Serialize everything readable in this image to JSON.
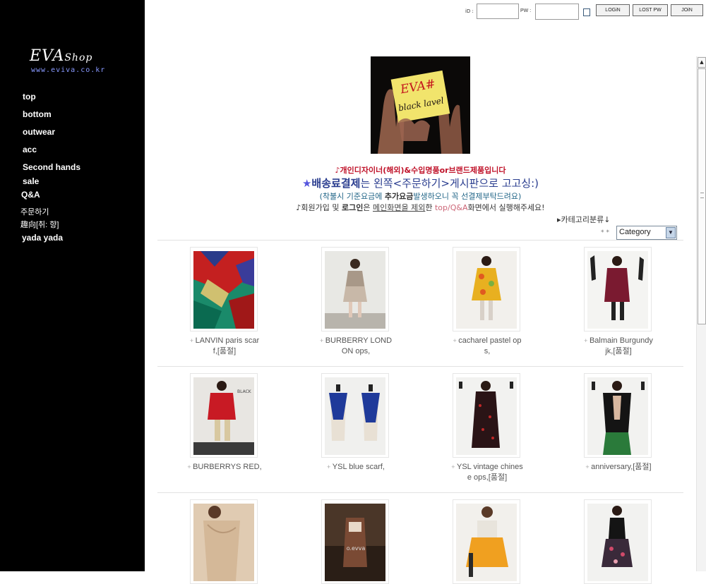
{
  "sidebar": {
    "logo_brand": "EVA",
    "logo_shop": "Shop",
    "logo_url": "www.eviva.co.kr",
    "items": [
      {
        "label": "top"
      },
      {
        "label": "bottom"
      },
      {
        "label": "outwear"
      },
      {
        "label": "acc"
      },
      {
        "label": "Second hands"
      },
      {
        "label": "sale"
      },
      {
        "label": "Q&A"
      },
      {
        "label": "주문하기"
      },
      {
        "label": "趣向[취:  향]"
      },
      {
        "label": "yada yada"
      }
    ]
  },
  "login": {
    "id_label": "iD :",
    "pw_label": "PW :",
    "login_button": "LOGiN",
    "lost_pw_button": "LOST PW",
    "join_button": "JOiN"
  },
  "banner": {
    "line1": "EVA#",
    "line2": "black lavel"
  },
  "notices": {
    "line1": "♪개인디자이너(해외)&수입명품or브랜드제품입니다",
    "line2_star": "★",
    "line2_bold": "배송료결제",
    "line2_rest": "는 왼쪽<주문하기>게시판으로 고고싱:)",
    "line3_a": "(착불시 기준요금에 ",
    "line3_bold": "추가요금",
    "line3_b": "발생하오니 꼭 선결제부탁드려요)",
    "line4_a": "♪회원가입 및 ",
    "line4_bold": "로그인",
    "line4_b": "은 ",
    "line4_u": "메인화면을 제외",
    "line4_c": "한 ",
    "line4_pink": "top/Q&A",
    "line4_d": "화면에서 실행해주세요!"
  },
  "category": {
    "label": "▸카테고리분류↓",
    "stars": "**",
    "selected": "Category"
  },
  "products": [
    {
      "name_line1": "LANVIN paris scar",
      "name_line2": "f,[품절]"
    },
    {
      "name_line1": "BURBERRY LOND",
      "name_line2": "ON ops,"
    },
    {
      "name_line1": "cacharel pastel op",
      "name_line2": "s,"
    },
    {
      "name_line1": "Balmain Burgundy",
      "name_line2": "jk,[품절]"
    },
    {
      "name_line1": "BURBERRYS RED,",
      "name_line2": ""
    },
    {
      "name_line1": "YSL blue scarf,",
      "name_line2": ""
    },
    {
      "name_line1": "YSL vintage chines",
      "name_line2": "e ops,[품절]"
    },
    {
      "name_line1": "anniversary,[품절]",
      "name_line2": ""
    },
    {
      "name_line1": "",
      "name_line2": ""
    },
    {
      "name_line1": "",
      "name_line2": ""
    },
    {
      "name_line1": "",
      "name_line2": ""
    },
    {
      "name_line1": "",
      "name_line2": ""
    }
  ],
  "image_labels": {
    "p5": "BLACK",
    "p10": "o.evva"
  },
  "colors": {
    "sidebar_bg": "#000000",
    "notice_red": "#c0132a",
    "notice_blue": "#2a3d8f"
  }
}
